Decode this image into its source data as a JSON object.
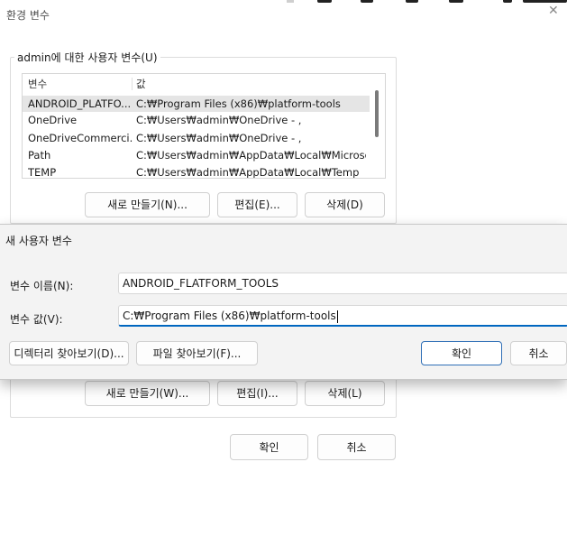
{
  "window": {
    "title": "환경 변수",
    "close_glyph": "✕"
  },
  "user_vars": {
    "legend": "admin에 대한 사용자 변수(U)",
    "columns": [
      "변수",
      "값"
    ],
    "rows": [
      {
        "name": "ANDROID_PLATFO...",
        "value": "C:₩Program Files (x86)₩platform-tools"
      },
      {
        "name": "OneDrive",
        "value": "C:₩Users₩admin₩OneDrive - ,"
      },
      {
        "name": "OneDriveCommerci...",
        "value": "C:₩Users₩admin₩OneDrive - ,"
      },
      {
        "name": "Path",
        "value": "C:₩Users₩admin₩AppData₩Local₩Microsoft..."
      },
      {
        "name": "TEMP",
        "value": "C:₩Users₩admin₩AppData₩Local₩Temp"
      }
    ],
    "buttons": {
      "new": "새로 만들기(N)...",
      "edit": "편집(E)...",
      "delete": "삭제(D)"
    }
  },
  "system_vars": {
    "buttons": {
      "new": "새로 만들기(W)...",
      "edit": "편집(I)...",
      "delete": "삭제(L)"
    }
  },
  "main_buttons": {
    "ok": "확인",
    "cancel": "취소"
  },
  "new_var_dialog": {
    "title": "새 사용자 변수",
    "name_label": "변수 이름(N):",
    "name_value": "ANDROID_FLATFORM_TOOLS",
    "value_label": "변수 값(V):",
    "value_value": "C:₩Program Files (x86)₩platform-tools",
    "buttons": {
      "browse_dir": "디렉터리 찾아보기(D)...",
      "browse_file": "파일 찾아보기(F)...",
      "ok": "확인",
      "cancel": "취소"
    }
  },
  "colors": {
    "accent": "#0067c0",
    "primary_border": "#2f6fb6",
    "selection": "#e5e5e5"
  }
}
